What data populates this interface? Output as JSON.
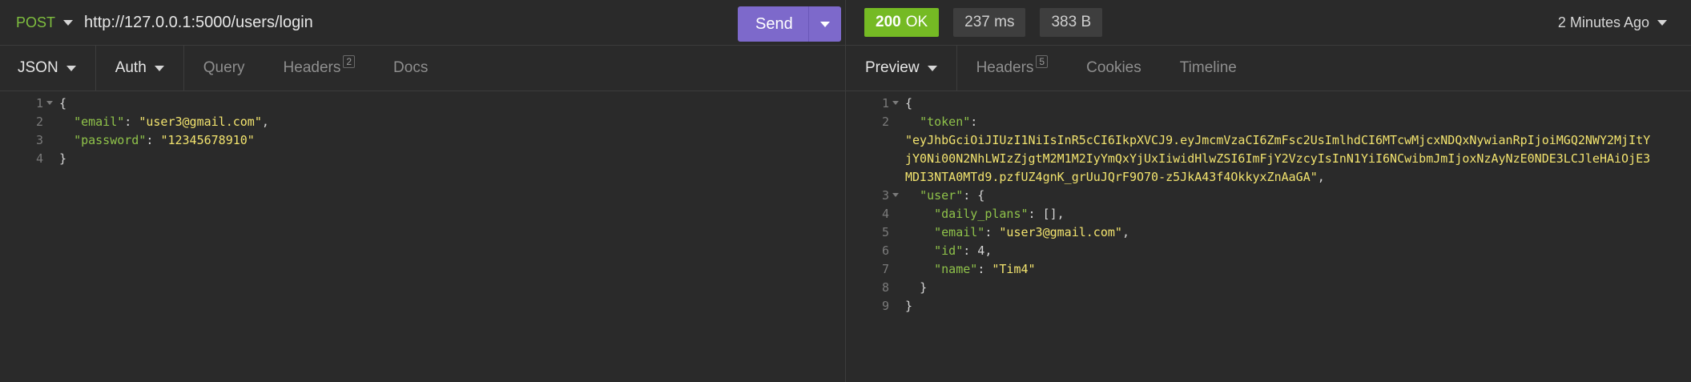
{
  "request": {
    "method": "POST",
    "url": "http://127.0.0.1:5000/users/login",
    "send_label": "Send",
    "tabs": {
      "body": "JSON",
      "auth": "Auth",
      "query": "Query",
      "headers": "Headers",
      "headers_count": "2",
      "docs": "Docs"
    },
    "body_lines": [
      {
        "n": "1",
        "text": "{"
      },
      {
        "n": "2",
        "key": "\"email\"",
        "sep": ": ",
        "val": "\"user3@gmail.com\"",
        "end": ","
      },
      {
        "n": "3",
        "key": "\"password\"",
        "sep": ": ",
        "val": "\"12345678910\"",
        "end": ""
      },
      {
        "n": "4",
        "text": "}"
      }
    ]
  },
  "response": {
    "status_code": "200",
    "status_text": "OK",
    "time": "237 ms",
    "size": "383 B",
    "time_ago": "2 Minutes Ago",
    "tabs": {
      "preview": "Preview",
      "headers": "Headers",
      "headers_count": "5",
      "cookies": "Cookies",
      "timeline": "Timeline"
    },
    "lines": {
      "l1": "{",
      "l2_key": "\"token\"",
      "l2_sep": ":",
      "token_1": "\"eyJhbGciOiJIUzI1NiIsInR5cCI6IkpXVCJ9.eyJmcmVzaCI6ZmFsc2UsImlhdCI6MTcwMjcxNDQxNywianRpIjoiMGQ2NWY2MjItY",
      "token_2": "jY0Ni00N2NhLWIzZjgtM2M1M2IyYmQxYjUxIiwidHlwZSI6ImFjY2VzcyIsInN1YiI6NCwibmJmIjoxNzAyNzE0NDE3LCJleHAiOjE3",
      "token_3": "MDI3NTA0MTd9.pzfUZ4gnK_grUuJQrF9O70-z5JkA43f4OkkyxZnAaGA\"",
      "token_end": ",",
      "l3_key": "\"user\"",
      "l3_rest": ": {",
      "l4_key": "\"daily_plans\"",
      "l4_rest": ": [],",
      "l5_key": "\"email\"",
      "l5_sep": ": ",
      "l5_val": "\"user3@gmail.com\"",
      "l5_end": ",",
      "l6_key": "\"id\"",
      "l6_rest": ": 4,",
      "l7_key": "\"name\"",
      "l7_sep": ": ",
      "l7_val": "\"Tim4\"",
      "l8": "}",
      "l9": "}",
      "numbers": [
        "1",
        "2",
        "3",
        "4",
        "5",
        "6",
        "7",
        "8",
        "9"
      ]
    }
  },
  "colors": {
    "background": "#2a2a2a",
    "accent": "#7d69cb",
    "status_ok": "#75ba24",
    "json_key": "#8fc24a",
    "json_string": "#f2e36e"
  }
}
